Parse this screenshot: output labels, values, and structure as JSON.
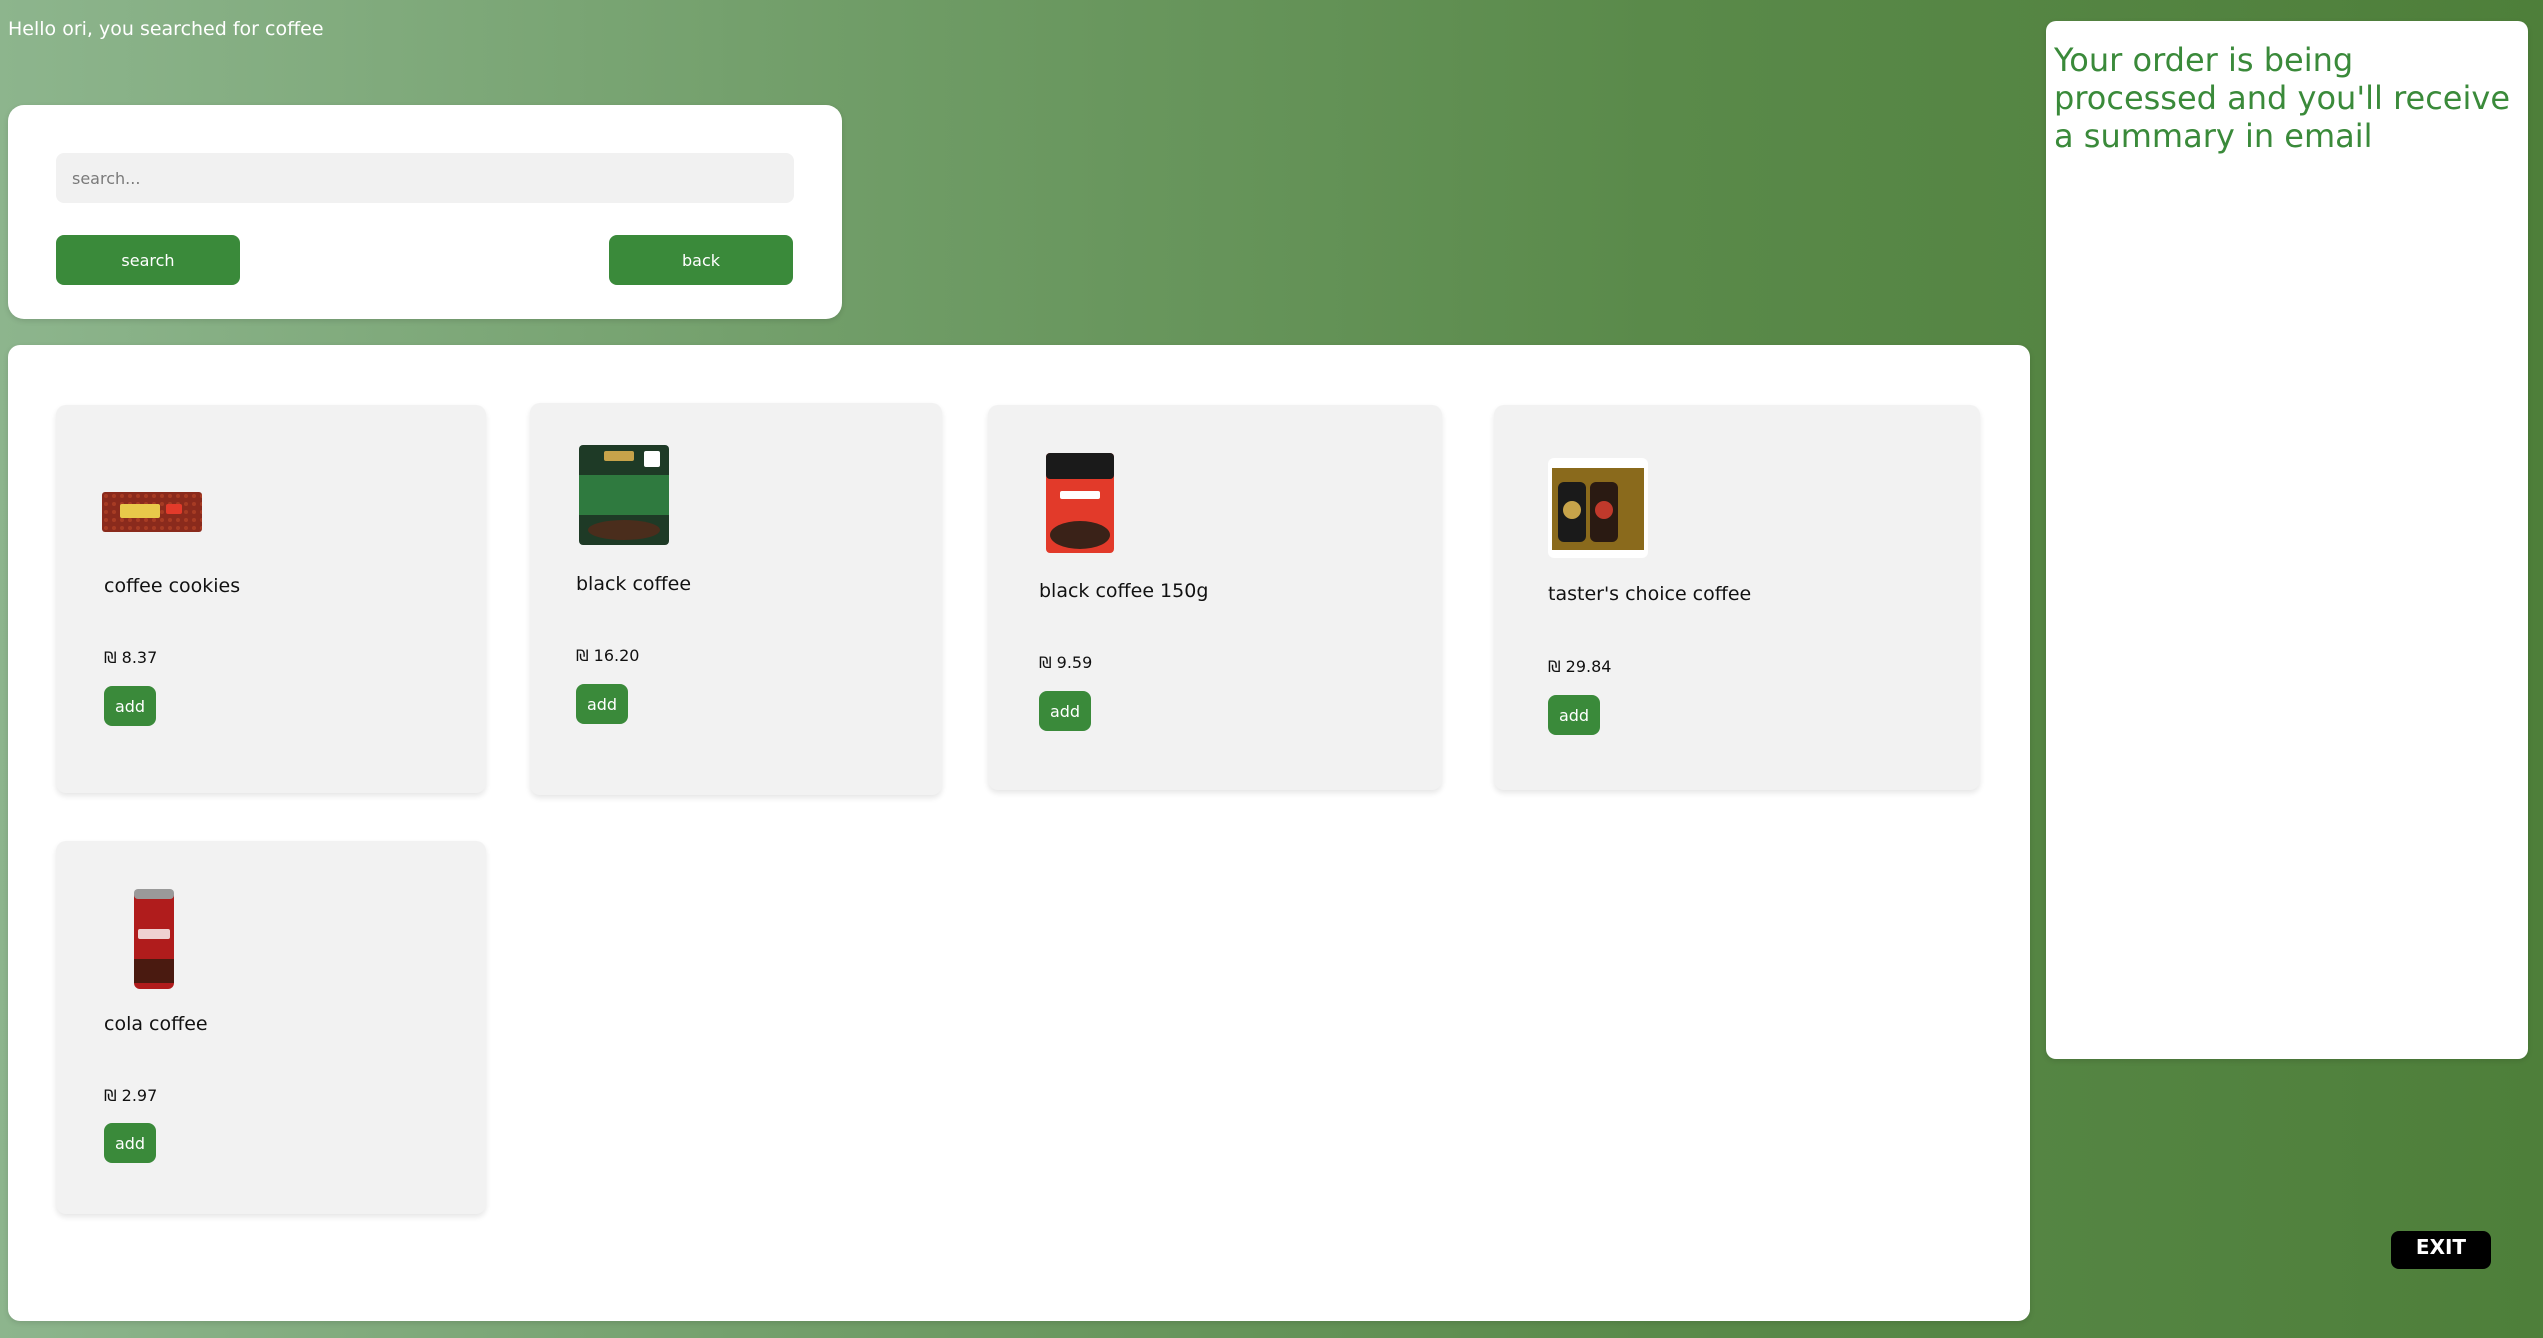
{
  "header": {
    "greeting": "Hello ori, you searched for coffee"
  },
  "search": {
    "placeholder": "search...",
    "value": "",
    "search_label": "search",
    "back_label": "back"
  },
  "products": [
    {
      "name": "coffee cookies",
      "price": "₪ 8.37",
      "add_label": "add",
      "image_icon": "coffee-cookies-package"
    },
    {
      "name": "black coffee",
      "price": "₪ 16.20",
      "add_label": "add",
      "image_icon": "black-coffee-bag"
    },
    {
      "name": "black coffee 150g",
      "price": "₪ 9.59",
      "add_label": "add",
      "image_icon": "red-coffee-bag"
    },
    {
      "name": "taster's choice coffee",
      "price": "₪ 29.84",
      "add_label": "add",
      "image_icon": "tasters-choice-box"
    },
    {
      "name": "cola coffee",
      "price": "₪ 2.97",
      "add_label": "add",
      "image_icon": "cola-can"
    }
  ],
  "order": {
    "message": "Your order is being processed and you'll receive a summary in email"
  },
  "exit_label": "EXIT",
  "colors": {
    "accent": "#3a8a3a",
    "panel": "#ffffff",
    "card": "#f2f2f2",
    "exit": "#000000"
  }
}
